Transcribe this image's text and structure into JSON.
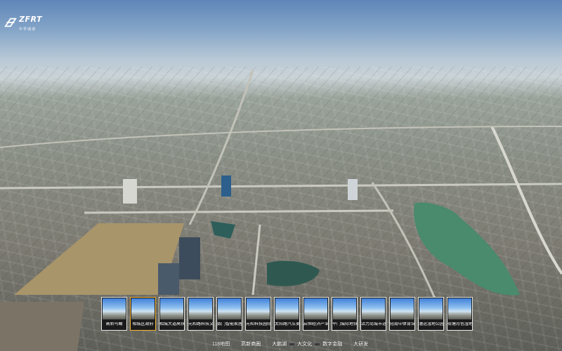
{
  "brand": {
    "name": "ZFRT",
    "tagline": "中孚瑞通"
  },
  "thumbnails": [
    {
      "label": "高新鸟瞰",
      "active": false
    },
    {
      "label": "相城区政府",
      "active": true
    },
    {
      "label": "相城大道高铁",
      "active": false
    },
    {
      "label": "元和路科技文",
      "active": false
    },
    {
      "label": "数门智能家居",
      "active": false
    },
    {
      "label": "元和科技园际",
      "active": false
    },
    {
      "label": "太阳路汽车美",
      "active": false
    },
    {
      "label": "启恒经济产业",
      "active": false
    },
    {
      "label": "平门城际地铁",
      "active": false
    },
    {
      "label": "活力岛城市运",
      "active": false
    },
    {
      "label": "轻霞中体育馆",
      "active": false
    },
    {
      "label": "漕运湿地公园",
      "active": false
    },
    {
      "label": "荷塘月色湿地",
      "active": false
    }
  ],
  "nav": [
    "118地图",
    "高新商圈",
    "大鹏湖",
    "大文化",
    "数字金融",
    "大研发"
  ],
  "colors": {
    "active_border": "#f3b43a",
    "thumb_border": "#e9e9e9"
  }
}
